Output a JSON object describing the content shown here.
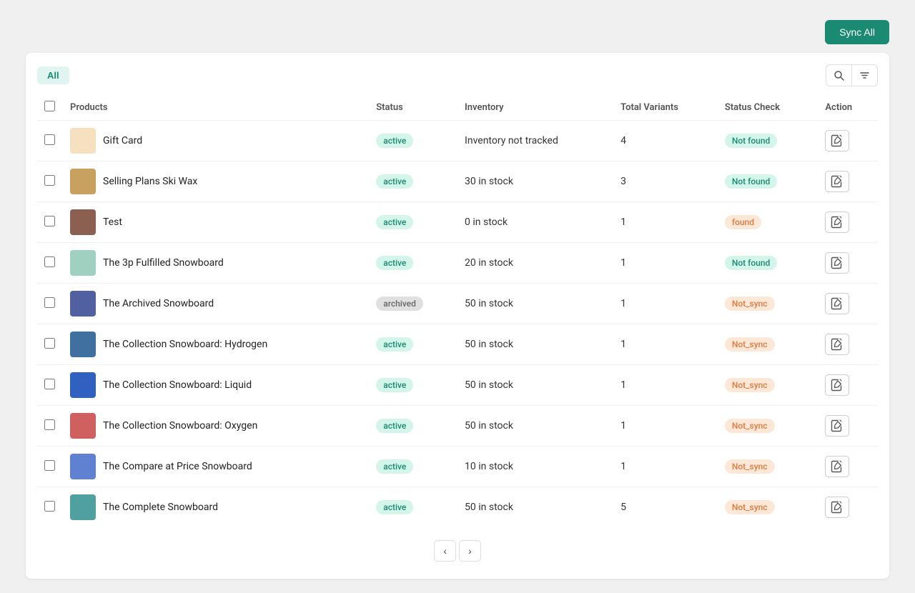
{
  "topBar": {
    "syncAllLabel": "Sync All"
  },
  "tabs": [
    {
      "label": "All",
      "active": true
    }
  ],
  "table": {
    "columns": [
      "Products",
      "Status",
      "Inventory",
      "Total Variants",
      "Status Check",
      "Action"
    ],
    "rows": [
      {
        "id": 1,
        "name": "Gift Card",
        "imgClass": "img-giftcard",
        "imgIcon": "🎁",
        "status": "active",
        "statusClass": "badge-active",
        "inventory": "Inventory not tracked",
        "totalVariants": "4",
        "statusCheck": "Not found",
        "statusCheckClass": "badge-not-found"
      },
      {
        "id": 2,
        "name": "Selling Plans Ski Wax",
        "imgClass": "img-skiwax",
        "imgIcon": "🟫",
        "status": "active",
        "statusClass": "badge-active",
        "inventory": "30 in stock",
        "totalVariants": "3",
        "statusCheck": "Not found",
        "statusCheckClass": "badge-not-found"
      },
      {
        "id": 3,
        "name": "Test",
        "imgClass": "img-test",
        "imgIcon": "🟤",
        "status": "active",
        "statusClass": "badge-active",
        "inventory": "0 in stock",
        "totalVariants": "1",
        "statusCheck": "found",
        "statusCheckClass": "badge-found"
      },
      {
        "id": 4,
        "name": "The 3p Fulfilled Snowboard",
        "imgClass": "img-snowboard-3p",
        "imgIcon": "🟩",
        "status": "active",
        "statusClass": "badge-active",
        "inventory": "20 in stock",
        "totalVariants": "1",
        "statusCheck": "Not found",
        "statusCheckClass": "badge-not-found"
      },
      {
        "id": 5,
        "name": "The Archived Snowboard",
        "imgClass": "img-archived",
        "imgIcon": "🟦",
        "status": "archived",
        "statusClass": "badge-archived",
        "inventory": "50 in stock",
        "totalVariants": "1",
        "statusCheck": "Not_sync",
        "statusCheckClass": "badge-not-sync"
      },
      {
        "id": 6,
        "name": "The Collection Snowboard: Hydrogen",
        "imgClass": "img-hydrogen",
        "imgIcon": "🔵",
        "status": "active",
        "statusClass": "badge-active",
        "inventory": "50 in stock",
        "totalVariants": "1",
        "statusCheck": "Not_sync",
        "statusCheckClass": "badge-not-sync"
      },
      {
        "id": 7,
        "name": "The Collection Snowboard: Liquid",
        "imgClass": "img-liquid",
        "imgIcon": "🔷",
        "status": "active",
        "statusClass": "badge-active",
        "inventory": "50 in stock",
        "totalVariants": "1",
        "statusCheck": "Not_sync",
        "statusCheckClass": "badge-not-sync"
      },
      {
        "id": 8,
        "name": "The Collection Snowboard: Oxygen",
        "imgClass": "img-oxygen",
        "imgIcon": "🔶",
        "status": "active",
        "statusClass": "badge-active",
        "inventory": "50 in stock",
        "totalVariants": "1",
        "statusCheck": "Not_sync",
        "statusCheckClass": "badge-not-sync"
      },
      {
        "id": 9,
        "name": "The Compare at Price Snowboard",
        "imgClass": "img-compare",
        "imgIcon": "🔵",
        "status": "active",
        "statusClass": "badge-active",
        "inventory": "10 in stock",
        "totalVariants": "1",
        "statusCheck": "Not_sync",
        "statusCheckClass": "badge-not-sync"
      },
      {
        "id": 10,
        "name": "The Complete Snowboard",
        "imgClass": "img-complete",
        "imgIcon": "🔷",
        "status": "active",
        "statusClass": "badge-active",
        "inventory": "50 in stock",
        "totalVariants": "5",
        "statusCheck": "Not_sync",
        "statusCheckClass": "badge-not-sync"
      }
    ]
  },
  "pagination": {
    "prevLabel": "‹",
    "nextLabel": "›"
  }
}
